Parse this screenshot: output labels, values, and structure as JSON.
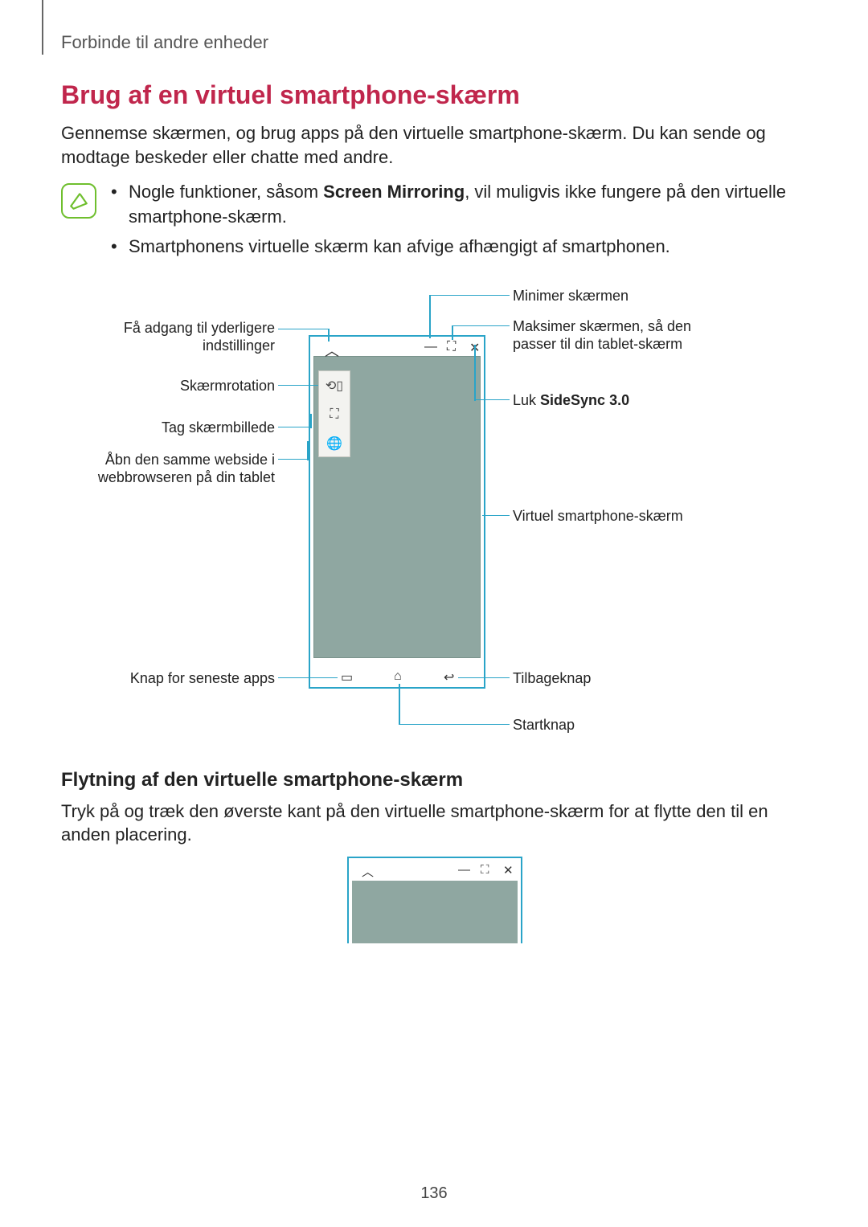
{
  "breadcrumb": "Forbinde til andre enheder",
  "heading": "Brug af en virtuel smartphone-skærm",
  "intro": "Gennemse skærmen, og brug apps på den virtuelle smartphone-skærm. Du kan sende og modtage beskeder eller chatte med andre.",
  "note": {
    "bullet1_pre": "Nogle funktioner, såsom ",
    "bullet1_bold": "Screen Mirroring",
    "bullet1_post": ", vil muligvis ikke fungere på den virtuelle smartphone-skærm.",
    "bullet2": "Smartphonens virtuelle skærm kan afvige afhængigt af smartphonen."
  },
  "labels": {
    "left": {
      "settings": "Få adgang til yderligere indstillinger",
      "rotate": "Skærmrotation",
      "screenshot": "Tag skærmbillede",
      "web": "Åbn den samme webside i webbrowseren på din tablet",
      "recent": "Knap for seneste apps"
    },
    "right": {
      "minimize": "Minimer skærmen",
      "maximize": "Maksimer skærmen, så den passer til din tablet-skærm",
      "close_pre": "Luk ",
      "close_bold": "SideSync 3.0",
      "virtual": "Virtuel smartphone-skærm",
      "back": "Tilbageknap",
      "home": "Startknap"
    }
  },
  "sub_heading": "Flytning af den virtuelle smartphone-skærm",
  "sub_body": "Tryk på og træk den øverste kant på den virtuelle smartphone-skærm for at flytte den til en anden placering.",
  "page_number": "136"
}
